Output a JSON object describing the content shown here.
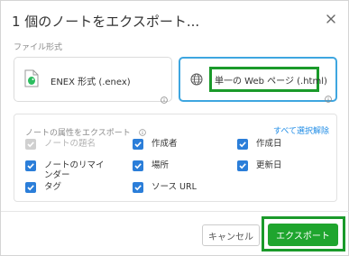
{
  "dialog": {
    "title": "1 個のノートをエクスポート...",
    "close_icon": "close-icon"
  },
  "file_format": {
    "section_label": "ファイル形式",
    "options": [
      {
        "label": "ENEX 形式 (.enex)",
        "icon": "evernote-file-icon",
        "selected": false
      },
      {
        "label": "単一の Web ページ (.html)",
        "icon": "globe-icon",
        "selected": true
      }
    ]
  },
  "attributes": {
    "section_label": "ノートの属性をエクスポート",
    "select_all_label": "すべて選択解除",
    "items": [
      {
        "label": "ノートの題名",
        "checked": true,
        "disabled": true
      },
      {
        "label": "作成者",
        "checked": true,
        "disabled": false
      },
      {
        "label": "作成日",
        "checked": true,
        "disabled": false
      },
      {
        "label": "ノートのリマインダー",
        "checked": true,
        "disabled": false
      },
      {
        "label": "場所",
        "checked": true,
        "disabled": false
      },
      {
        "label": "更新日",
        "checked": true,
        "disabled": false
      },
      {
        "label": "タグ",
        "checked": true,
        "disabled": false
      },
      {
        "label": "ソース URL",
        "checked": true,
        "disabled": false
      }
    ]
  },
  "buttons": {
    "cancel_label": "キャンセル",
    "export_label": "エクスポート"
  },
  "colors": {
    "accent_blue": "#2b7ed9",
    "selected_border": "#3ea6e0",
    "export_green": "#1fa52e",
    "annotation_green": "#1a9a2a",
    "link_blue": "#1f8ce6"
  }
}
